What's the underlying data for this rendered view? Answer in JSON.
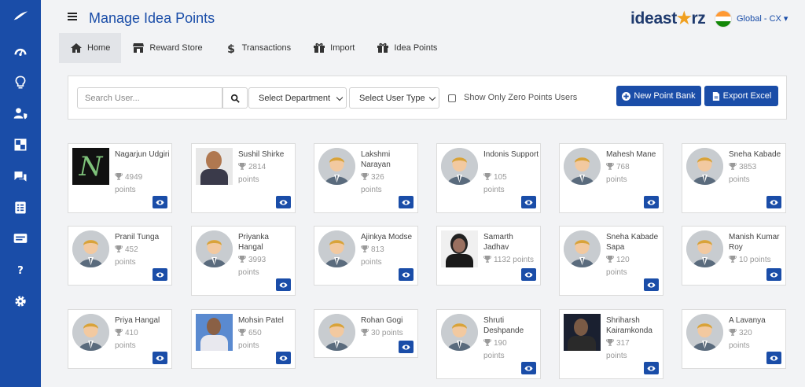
{
  "app": {
    "title": "Manage Idea Points",
    "logo": "ideastorz",
    "region": "Global - CX"
  },
  "sidebar": {
    "items": [
      {
        "icon": "logo-icon"
      },
      {
        "icon": "dashboard-icon"
      },
      {
        "icon": "lightbulb-icon"
      },
      {
        "icon": "user-shield-icon"
      },
      {
        "icon": "grid-icon"
      },
      {
        "icon": "chat-icon"
      },
      {
        "icon": "list-icon"
      },
      {
        "icon": "card-icon"
      },
      {
        "icon": "help-icon"
      },
      {
        "icon": "gear-icon"
      }
    ]
  },
  "tabs": [
    {
      "label": "Home",
      "icon": "home-icon",
      "active": true
    },
    {
      "label": "Reward Store",
      "icon": "store-icon",
      "active": false
    },
    {
      "label": "Transactions",
      "icon": "dollar-icon",
      "active": false
    },
    {
      "label": "Import",
      "icon": "gift-icon",
      "active": false
    },
    {
      "label": "Idea Points",
      "icon": "gift-icon",
      "active": false
    }
  ],
  "toolbar": {
    "search_placeholder": "Search User...",
    "department": "Select Department",
    "user_type": "Select User Type",
    "zero_points_label": "Show Only Zero Points Users",
    "new_bank_label": "New Point Bank",
    "export_label": "Export Excel"
  },
  "colors": {
    "primary": "#1a4da8",
    "trophy": "#999999"
  },
  "users": [
    {
      "name": "Nagarjun Udgiri",
      "points": "4949",
      "unit": "points",
      "avatar": "photo"
    },
    {
      "name": "Sushil Shirke",
      "points": "2814",
      "unit": "points",
      "avatar": "photo"
    },
    {
      "name": "Lakshmi Narayan",
      "points": "326",
      "unit": "points",
      "avatar": "default"
    },
    {
      "name": "Indonis Support",
      "points": "105",
      "unit": "points",
      "avatar": "default"
    },
    {
      "name": "Mahesh Mane",
      "points": "768",
      "unit": "points",
      "avatar": "default"
    },
    {
      "name": "Sneha Kabade",
      "points": "3853",
      "unit": "points",
      "avatar": "default"
    },
    {
      "name": "Pranil Tunga",
      "points": "452",
      "unit": "points",
      "avatar": "default"
    },
    {
      "name": "Priyanka Hangal",
      "points": "3993",
      "unit": "points",
      "avatar": "default"
    },
    {
      "name": "Ajinkya Modse",
      "points": "813",
      "unit": "points",
      "avatar": "default"
    },
    {
      "name": "Samarth Jadhav",
      "points": "1132",
      "unit": "points",
      "avatar": "photo"
    },
    {
      "name": "Sneha Kabade Sapa",
      "points": "120",
      "unit": "points",
      "avatar": "default"
    },
    {
      "name": "Manish Kumar Roy",
      "points": "10",
      "unit": "points",
      "avatar": "default"
    },
    {
      "name": "Priya Hangal",
      "points": "410",
      "unit": "points",
      "avatar": "default"
    },
    {
      "name": "Mohsin Patel",
      "points": "650",
      "unit": "points",
      "avatar": "photo"
    },
    {
      "name": "Rohan Gogi",
      "points": "30",
      "unit": "points",
      "avatar": "default"
    },
    {
      "name": "Shruti Deshpande",
      "points": "190",
      "unit": "points",
      "avatar": "default"
    },
    {
      "name": "Shriharsh Kairamkonda",
      "points": "317",
      "unit": "points",
      "avatar": "photo"
    },
    {
      "name": "A Lavanya",
      "points": "320",
      "unit": "points",
      "avatar": "default"
    }
  ]
}
